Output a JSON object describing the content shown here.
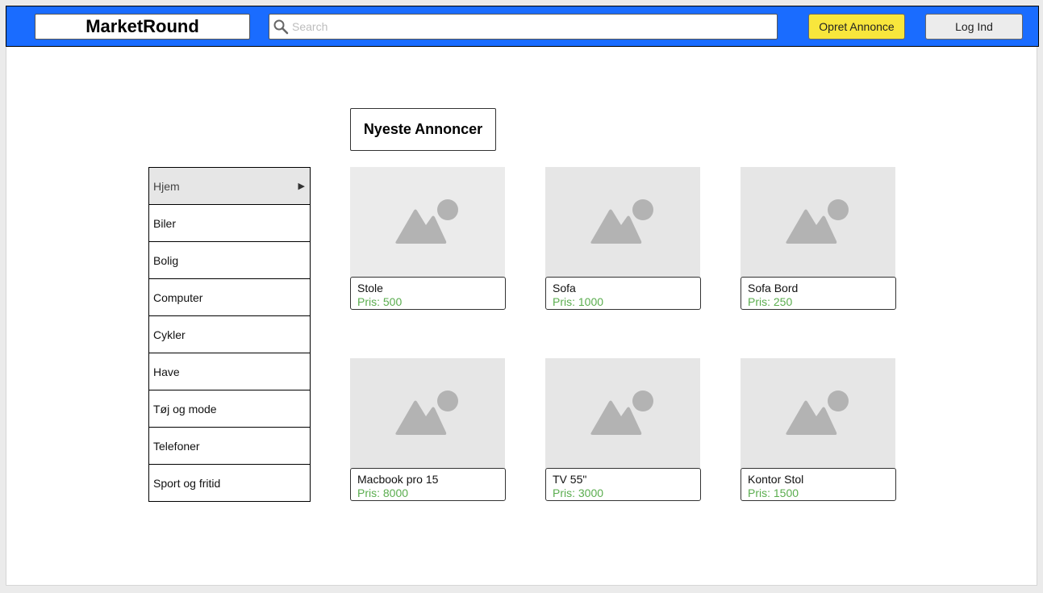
{
  "header": {
    "logo": "MarketRound",
    "search_placeholder": "Search",
    "search_value": "",
    "create_button": "Opret Annonce",
    "login_button": "Log Ind",
    "bar_color": "#1a6cff",
    "create_button_color": "#f8e63c"
  },
  "main": {
    "section_title": "Nyeste Annoncer"
  },
  "sidebar": {
    "items": [
      {
        "label": "Hjem",
        "active": true
      },
      {
        "label": "Biler"
      },
      {
        "label": "Bolig"
      },
      {
        "label": "Computer"
      },
      {
        "label": "Cykler"
      },
      {
        "label": "Have"
      },
      {
        "label": "Tøj og mode"
      },
      {
        "label": "Telefoner"
      },
      {
        "label": "Sport og fritid"
      }
    ]
  },
  "listings": [
    {
      "title": "Stole",
      "price": "Pris: 500",
      "icon": "image-placeholder-icon"
    },
    {
      "title": "Sofa",
      "price": "Pris: 1000",
      "icon": "image-placeholder-icon"
    },
    {
      "title": "Sofa Bord",
      "price": "Pris: 250",
      "icon": "image-placeholder-icon"
    },
    {
      "title": "Macbook pro 15",
      "price": "Pris: 8000",
      "icon": "image-placeholder-icon"
    },
    {
      "title": "TV 55\"",
      "price": "Pris: 3000",
      "icon": "image-placeholder-icon"
    },
    {
      "title": "Kontor Stol",
      "price": "Pris: 1500",
      "icon": "image-placeholder-icon"
    }
  ],
  "colors": {
    "price": "#5aad4e",
    "placeholder_bg": "#e6e6e6"
  }
}
